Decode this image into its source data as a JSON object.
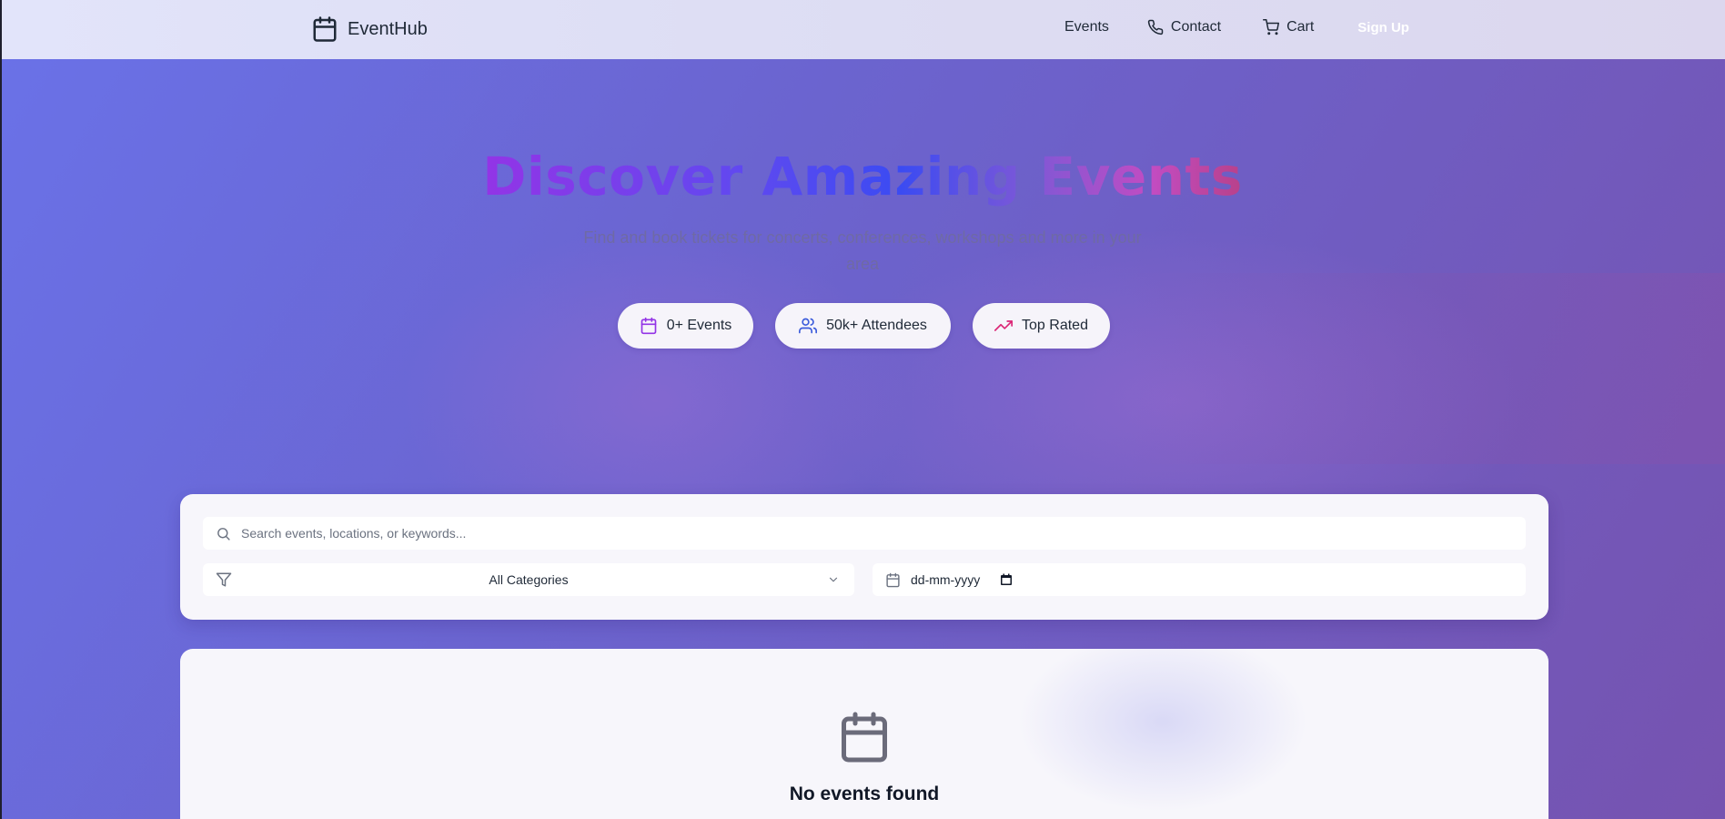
{
  "colors": {
    "accent_purple": "#9334e6",
    "accent_blue": "#3b4bf2",
    "accent_pink": "#db2777",
    "text_dark": "#1f2937"
  },
  "navbar": {
    "brand": "EventHub",
    "brand_icon": "calendar-icon",
    "links": [
      {
        "label": "Events"
      },
      {
        "label": "Contact",
        "icon": "phone-icon"
      },
      {
        "label": "Cart",
        "icon": "cart-icon"
      },
      {
        "label": "Sign Up"
      }
    ]
  },
  "hero": {
    "title": "Discover Amazing Events",
    "subtitle": "Find and book tickets for concerts, conferences, workshops and more in your area",
    "stats": [
      {
        "label": "0+ Events",
        "icon": "calendar-icon"
      },
      {
        "label": "50k+ Attendees",
        "icon": "users-icon"
      },
      {
        "label": "Top Rated",
        "icon": "trending-up-icon"
      }
    ]
  },
  "filters": {
    "search_placeholder": "Search events, locations, or keywords...",
    "category_selected": "All Categories",
    "date_placeholder": "dd-mm-yyyy"
  },
  "results": {
    "empty_title": "No events found"
  }
}
